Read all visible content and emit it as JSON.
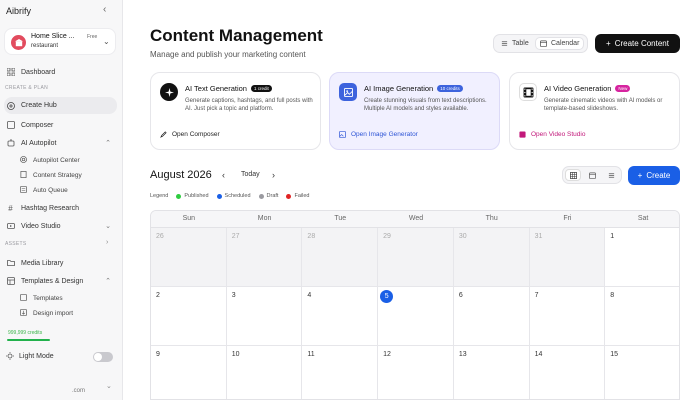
{
  "app": {
    "brand": "Aibrify"
  },
  "business": {
    "name": "Home Slice ...",
    "type": "restaurant",
    "plan": "Free"
  },
  "sidebar": {
    "section_create": "CREATE & PLAN",
    "section_assets": "ASSETS",
    "items": {
      "dashboard": "Dashboard",
      "create_hub": "Create Hub",
      "composer": "Composer",
      "ai_autopilot": "AI Autopilot",
      "autopilot_center": "Autopilot Center",
      "content_strategy": "Content Strategy",
      "auto_queue": "Auto Queue",
      "hashtag_research": "Hashtag Research",
      "video_studio": "Video Studio",
      "media_library": "Media Library",
      "templates_design": "Templates & Design",
      "templates": "Templates",
      "design_import": "Design import"
    },
    "credits": "999,999 credits",
    "light_mode": "Light Mode",
    "footer_domain": ".com"
  },
  "header": {
    "title": "Content Management",
    "subtitle": "Manage and publish your marketing content",
    "view_table": "Table",
    "view_calendar": "Calendar",
    "create_content": "Create Content"
  },
  "cards": [
    {
      "title": "AI Text Generation",
      "badge": "1 credit",
      "desc": "Generate captions, hashtags, and full posts with AI. Just pick a topic and platform.",
      "link": "Open Composer"
    },
    {
      "title": "AI Image Generation",
      "badge": "10 credits",
      "desc": "Create stunning visuals from text descriptions. Multiple AI models and styles available.",
      "link": "Open Image Generator"
    },
    {
      "title": "AI Video Generation",
      "badge": "New",
      "desc": "Generate cinematic videos with AI models or template-based slideshows.",
      "link": "Open Video Studio"
    }
  ],
  "calendar": {
    "month_label": "August 2026",
    "today_label": "Today",
    "create_label": "Create",
    "legend_label": "Legend",
    "legend": [
      {
        "label": "Published",
        "color": "#2ecc40"
      },
      {
        "label": "Scheduled",
        "color": "#1a5fe6"
      },
      {
        "label": "Draft",
        "color": "#9a9aa0"
      },
      {
        "label": "Failed",
        "color": "#e02424"
      }
    ],
    "weekdays": [
      "Sun",
      "Mon",
      "Tue",
      "Wed",
      "Thu",
      "Fri",
      "Sat"
    ],
    "rows": [
      [
        "26",
        "27",
        "28",
        "29",
        "30",
        "31",
        "1"
      ],
      [
        "2",
        "3",
        "4",
        "5",
        "6",
        "7",
        "8"
      ],
      [
        "9",
        "10",
        "11",
        "12",
        "13",
        "14",
        "15"
      ]
    ],
    "today": "5"
  },
  "colors": {
    "accent": "#1a5fe6",
    "dark": "#111111",
    "credits": "#22b14c"
  }
}
